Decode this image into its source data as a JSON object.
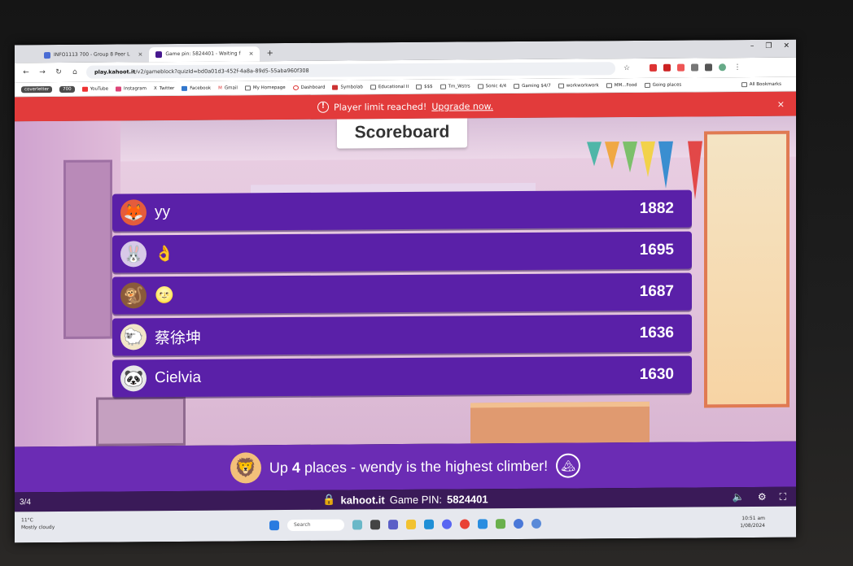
{
  "browser": {
    "tabs": [
      {
        "title": "INFO1113 700 - Group 8 Peer L",
        "color": "#4a6cd4"
      },
      {
        "title": "Game pin: 5824401 - Waiting f",
        "color": "#46178f",
        "active": true
      }
    ],
    "new_tab": "+",
    "window_controls": [
      "–",
      "❐",
      "✕"
    ],
    "address_host": "play.kahoot.it",
    "address_path": "/v2/gameblock?quizId=bd0a01d3-452f-4a8a-89d5-55aba960f308",
    "bookmarks": [
      "YouTube",
      "Instagram",
      "Twitter",
      "Facebook",
      "Gmail",
      "My Homepage",
      "Dashboard",
      "Symbolab",
      "Educational II",
      "$$$",
      "Tm_Wstrs",
      "Sonic 4/4",
      "Gaming $4/7",
      "workworkwork",
      "MM...Food",
      "Going places"
    ],
    "bookmark_pills": [
      "coverletter",
      "700"
    ],
    "all_bookmarks": "All Bookmarks"
  },
  "alert": {
    "text": "Player limit reached!",
    "link": "Upgrade now.",
    "close": "×"
  },
  "game": {
    "title": "Scoreboard",
    "players": [
      {
        "name": "yy",
        "score": "1882",
        "avatar": "🦊"
      },
      {
        "name": "👌",
        "score": "1695",
        "avatar": "🐰"
      },
      {
        "name": "🌝",
        "score": "1687",
        "avatar": "🐒"
      },
      {
        "name": "蔡徐坤",
        "score": "1636",
        "avatar": "🐑"
      },
      {
        "name": "Cielvia",
        "score": "1630",
        "avatar": "🐼"
      }
    ],
    "climber_prefix": "Up ",
    "climber_places": "4",
    "climber_suffix": " places - wendy is the highest climber!",
    "climber_avatar": "🦁",
    "climber_icon": "🏔"
  },
  "footer": {
    "progress": "3/4",
    "host": "kahoot.it",
    "pin_label": "Game PIN:",
    "pin": "5824401"
  },
  "taskbar": {
    "weather_temp": "11°C",
    "weather_desc": "Mostly cloudy",
    "search": "Search",
    "time": "10:51 am",
    "date": "1/08/2024"
  },
  "colors": {
    "row_bg": "#5a20a8",
    "alert_bg": "#e23b3b",
    "climber_bg": "#6b2cb4",
    "footer_bg": "#3a1a58"
  }
}
